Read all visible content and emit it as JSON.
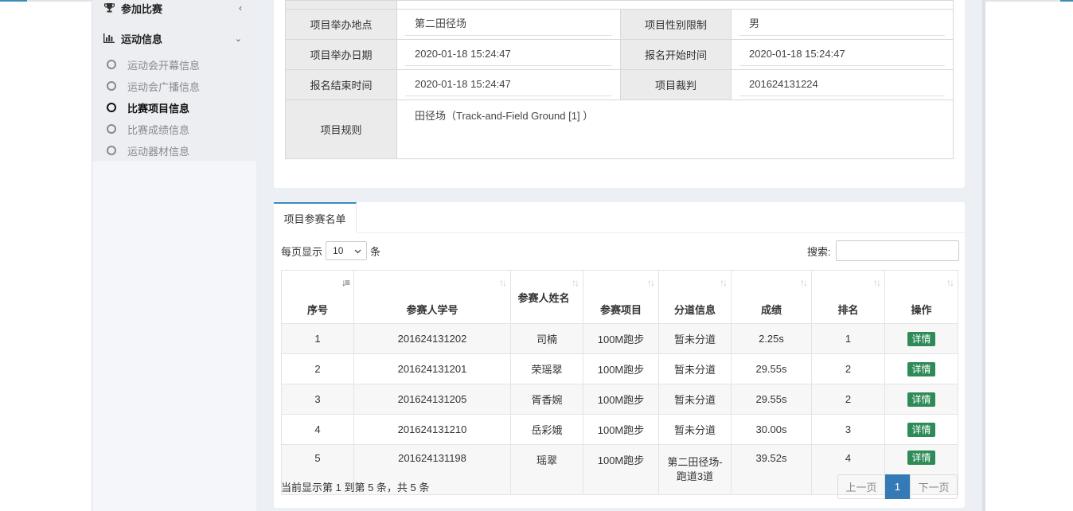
{
  "sidebar": {
    "join": {
      "label": "参加比赛",
      "icon": "trophy-icon"
    },
    "sport": {
      "label": "运动信息",
      "icon": "bar-chart-icon"
    },
    "items": [
      {
        "label": "运动会开幕信息"
      },
      {
        "label": "运动会广播信息"
      },
      {
        "label": "比赛项目信息"
      },
      {
        "label": "比赛成绩信息"
      },
      {
        "label": "运动器材信息"
      }
    ]
  },
  "details": {
    "place_label": "项目举办地点",
    "place": "第二田径场",
    "gender_label": "项目性别限制",
    "gender": "男",
    "date_label": "项目举办日期",
    "date": "2020-01-18 15:24:47",
    "reg_start_label": "报名开始时间",
    "reg_start": "2020-01-18 15:24:47",
    "reg_end_label": "报名结束时间",
    "reg_end": "2020-01-18 15:24:47",
    "referee_label": "项目裁判",
    "referee": "201624131224",
    "rules_label": "项目规则",
    "rules": "田径场（Track-and-Field Ground [1] ）"
  },
  "roster": {
    "tab": "项目参赛名单",
    "per_page_prefix": "每页显示",
    "per_page_value": "10",
    "per_page_suffix": "条",
    "search_label": "搜索:",
    "headers": [
      "序号",
      "参赛人学号",
      "参赛人姓名",
      "参赛项目",
      "分道信息",
      "成绩",
      "排名",
      "操作"
    ],
    "rows": [
      {
        "no": "1",
        "id": "201624131202",
        "name": "司楠",
        "event": "100M跑步",
        "lane": "暂未分道",
        "score": "2.25s",
        "rank": "1",
        "action": "详情"
      },
      {
        "no": "2",
        "id": "201624131201",
        "name": "荣瑶翠",
        "event": "100M跑步",
        "lane": "暂未分道",
        "score": "29.55s",
        "rank": "2",
        "action": "详情"
      },
      {
        "no": "3",
        "id": "201624131205",
        "name": "胥香婉",
        "event": "100M跑步",
        "lane": "暂未分道",
        "score": "29.55s",
        "rank": "2",
        "action": "详情"
      },
      {
        "no": "4",
        "id": "201624131210",
        "name": "岳彩娥",
        "event": "100M跑步",
        "lane": "暂未分道",
        "score": "30.00s",
        "rank": "3",
        "action": "详情"
      },
      {
        "no": "5",
        "id": "201624131198",
        "name": "瑶翠",
        "event": "100M跑步",
        "lane": "第二田径场-跑道3道",
        "score": "39.52s",
        "rank": "4",
        "action": "详情"
      }
    ],
    "info": "当前显示第 1 到第 5 条，共 5 条",
    "prev": "上一页",
    "page": "1",
    "next": "下一页"
  },
  "colors": {
    "accent": "#3c8dbc",
    "detail_button": "#2e8b57",
    "page_active": "#337ab7"
  }
}
